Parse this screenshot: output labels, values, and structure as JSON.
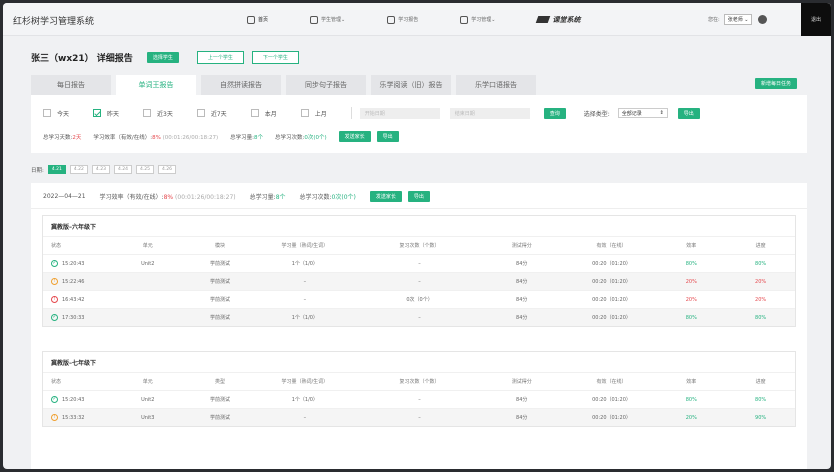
{
  "app": {
    "title": "红杉树学习管理系统"
  },
  "nav": [
    {
      "label": "首页",
      "active": true,
      "icon": "home-icon"
    },
    {
      "label": "学生管理",
      "active": false,
      "icon": "student-icon"
    },
    {
      "label": "学习报告",
      "active": false,
      "icon": "report-icon"
    },
    {
      "label": "学习管理",
      "active": false,
      "icon": "manage-icon"
    }
  ],
  "brand": "课堂系统",
  "user": {
    "label": "您在:",
    "name": "张老师",
    "logout": "退出"
  },
  "header": {
    "student": "张三（wx21）",
    "title": "详细报告",
    "select_student": "选择学生",
    "prev": "上一个学生",
    "next": "下一个学生"
  },
  "tabs": [
    {
      "label": "每日报告",
      "active": false
    },
    {
      "label": "单词王报告",
      "active": true
    },
    {
      "label": "自然拼读报告",
      "active": false
    },
    {
      "label": "同步句子报告",
      "active": false
    },
    {
      "label": "乐学阅读（旧）报告",
      "active": false
    },
    {
      "label": "乐学口语报告",
      "active": false
    }
  ],
  "new_task": "新增每日任务",
  "filters": {
    "options": [
      {
        "label": "今天",
        "checked": false
      },
      {
        "label": "昨天",
        "checked": true
      },
      {
        "label": "近3天",
        "checked": false
      },
      {
        "label": "近7天",
        "checked": false
      },
      {
        "label": "本月",
        "checked": false
      },
      {
        "label": "上月",
        "checked": false
      }
    ],
    "start_placeholder": "开始日期",
    "end_placeholder": "结束日期",
    "query": "查询",
    "type_label": "选择类型:",
    "type_value": "全部记录",
    "export": "导出"
  },
  "summary": {
    "days_label": "总学习天数:",
    "days": "2天",
    "eff_label": "学习效率（有效/在线）:",
    "eff": "8%",
    "eff_time": "(00:01:26/00:18:27)",
    "amount_label": "总学习量:",
    "amount": "8个",
    "review_label": "总学习次数:",
    "review": "0次",
    "review_sub": "(0个)",
    "send": "发送家长",
    "export": "导出"
  },
  "dates": {
    "label": "日期:",
    "items": [
      {
        "label": "4.21",
        "on": true
      },
      {
        "label": "4.22",
        "on": false
      },
      {
        "label": "4.23",
        "on": false
      },
      {
        "label": "4.24",
        "on": false
      },
      {
        "label": "4.25",
        "on": false
      },
      {
        "label": "4.26",
        "on": false
      }
    ]
  },
  "day": {
    "date": "2022—04—21",
    "eff_label": "学习效率（有效/在线）:",
    "eff": "8%",
    "eff_time": "(00:01:26/00:18:27)",
    "amount_label": "总学习量:",
    "amount": "8个",
    "review_label": "总学习次数:",
    "review": "0次",
    "review_sub": "(0个)",
    "send": "发送家长",
    "export": "导出"
  },
  "cards": [
    {
      "title": "冀教版–六年级下",
      "columns": [
        "状态",
        "单元",
        "模块",
        "学习量（熟词/生词）",
        "复习次数（个数）",
        "测试得分",
        "有效（在线）",
        "效率",
        "进度"
      ],
      "rows": [
        {
          "status": "ok",
          "time": "15:20:43",
          "unit": "Unit2",
          "module": "学前测试",
          "amount": "1个（1/0）",
          "review": "–",
          "score": "84分",
          "online": "00:20（01:20）",
          "eff": "80%",
          "eff_color": "green",
          "progress": "80%",
          "prog_color": "green"
        },
        {
          "status": "warn",
          "time": "15:22:46",
          "unit": "",
          "module": "学前测试",
          "amount": "–",
          "review": "–",
          "score": "84分",
          "online": "00:20（01:20）",
          "eff": "20%",
          "eff_color": "red",
          "progress": "20%",
          "prog_color": "red"
        },
        {
          "status": "err",
          "time": "16:43:42",
          "unit": "",
          "module": "学前测试",
          "amount": "–",
          "review": "0次（0个）",
          "score": "84分",
          "online": "00:20（01:20）",
          "eff": "20%",
          "eff_color": "red",
          "progress": "20%",
          "prog_color": "red"
        },
        {
          "status": "ok",
          "time": "17:30:33",
          "unit": "",
          "module": "学前测试",
          "amount": "1个（1/0）",
          "review": "–",
          "score": "84分",
          "online": "00:20（01:20）",
          "eff": "80%",
          "eff_color": "green",
          "progress": "80%",
          "prog_color": "green"
        }
      ]
    },
    {
      "title": "冀教版–七年级下",
      "columns": [
        "状态",
        "单元",
        "类型",
        "学习量（熟词/生词）",
        "复习次数（个数）",
        "测试得分",
        "有效（在线）",
        "效率",
        "进度"
      ],
      "rows": [
        {
          "status": "ok",
          "time": "15:20:43",
          "unit": "Unit2",
          "module": "学前测试",
          "amount": "1个（1/0）",
          "review": "–",
          "score": "84分",
          "online": "00:20（01:20）",
          "eff": "80%",
          "eff_color": "green",
          "progress": "80%",
          "prog_color": "green"
        },
        {
          "status": "warn",
          "time": "15:33:32",
          "unit": "Unit3",
          "module": "学前测试",
          "amount": "–",
          "review": "–",
          "score": "84分",
          "online": "00:20（01:20）",
          "eff": "20%",
          "eff_color": "green",
          "progress": "90%",
          "prog_color": "green"
        }
      ]
    }
  ],
  "colors": {
    "accent": "#26b280",
    "danger": "#e5484d",
    "warning": "#f0a030"
  }
}
